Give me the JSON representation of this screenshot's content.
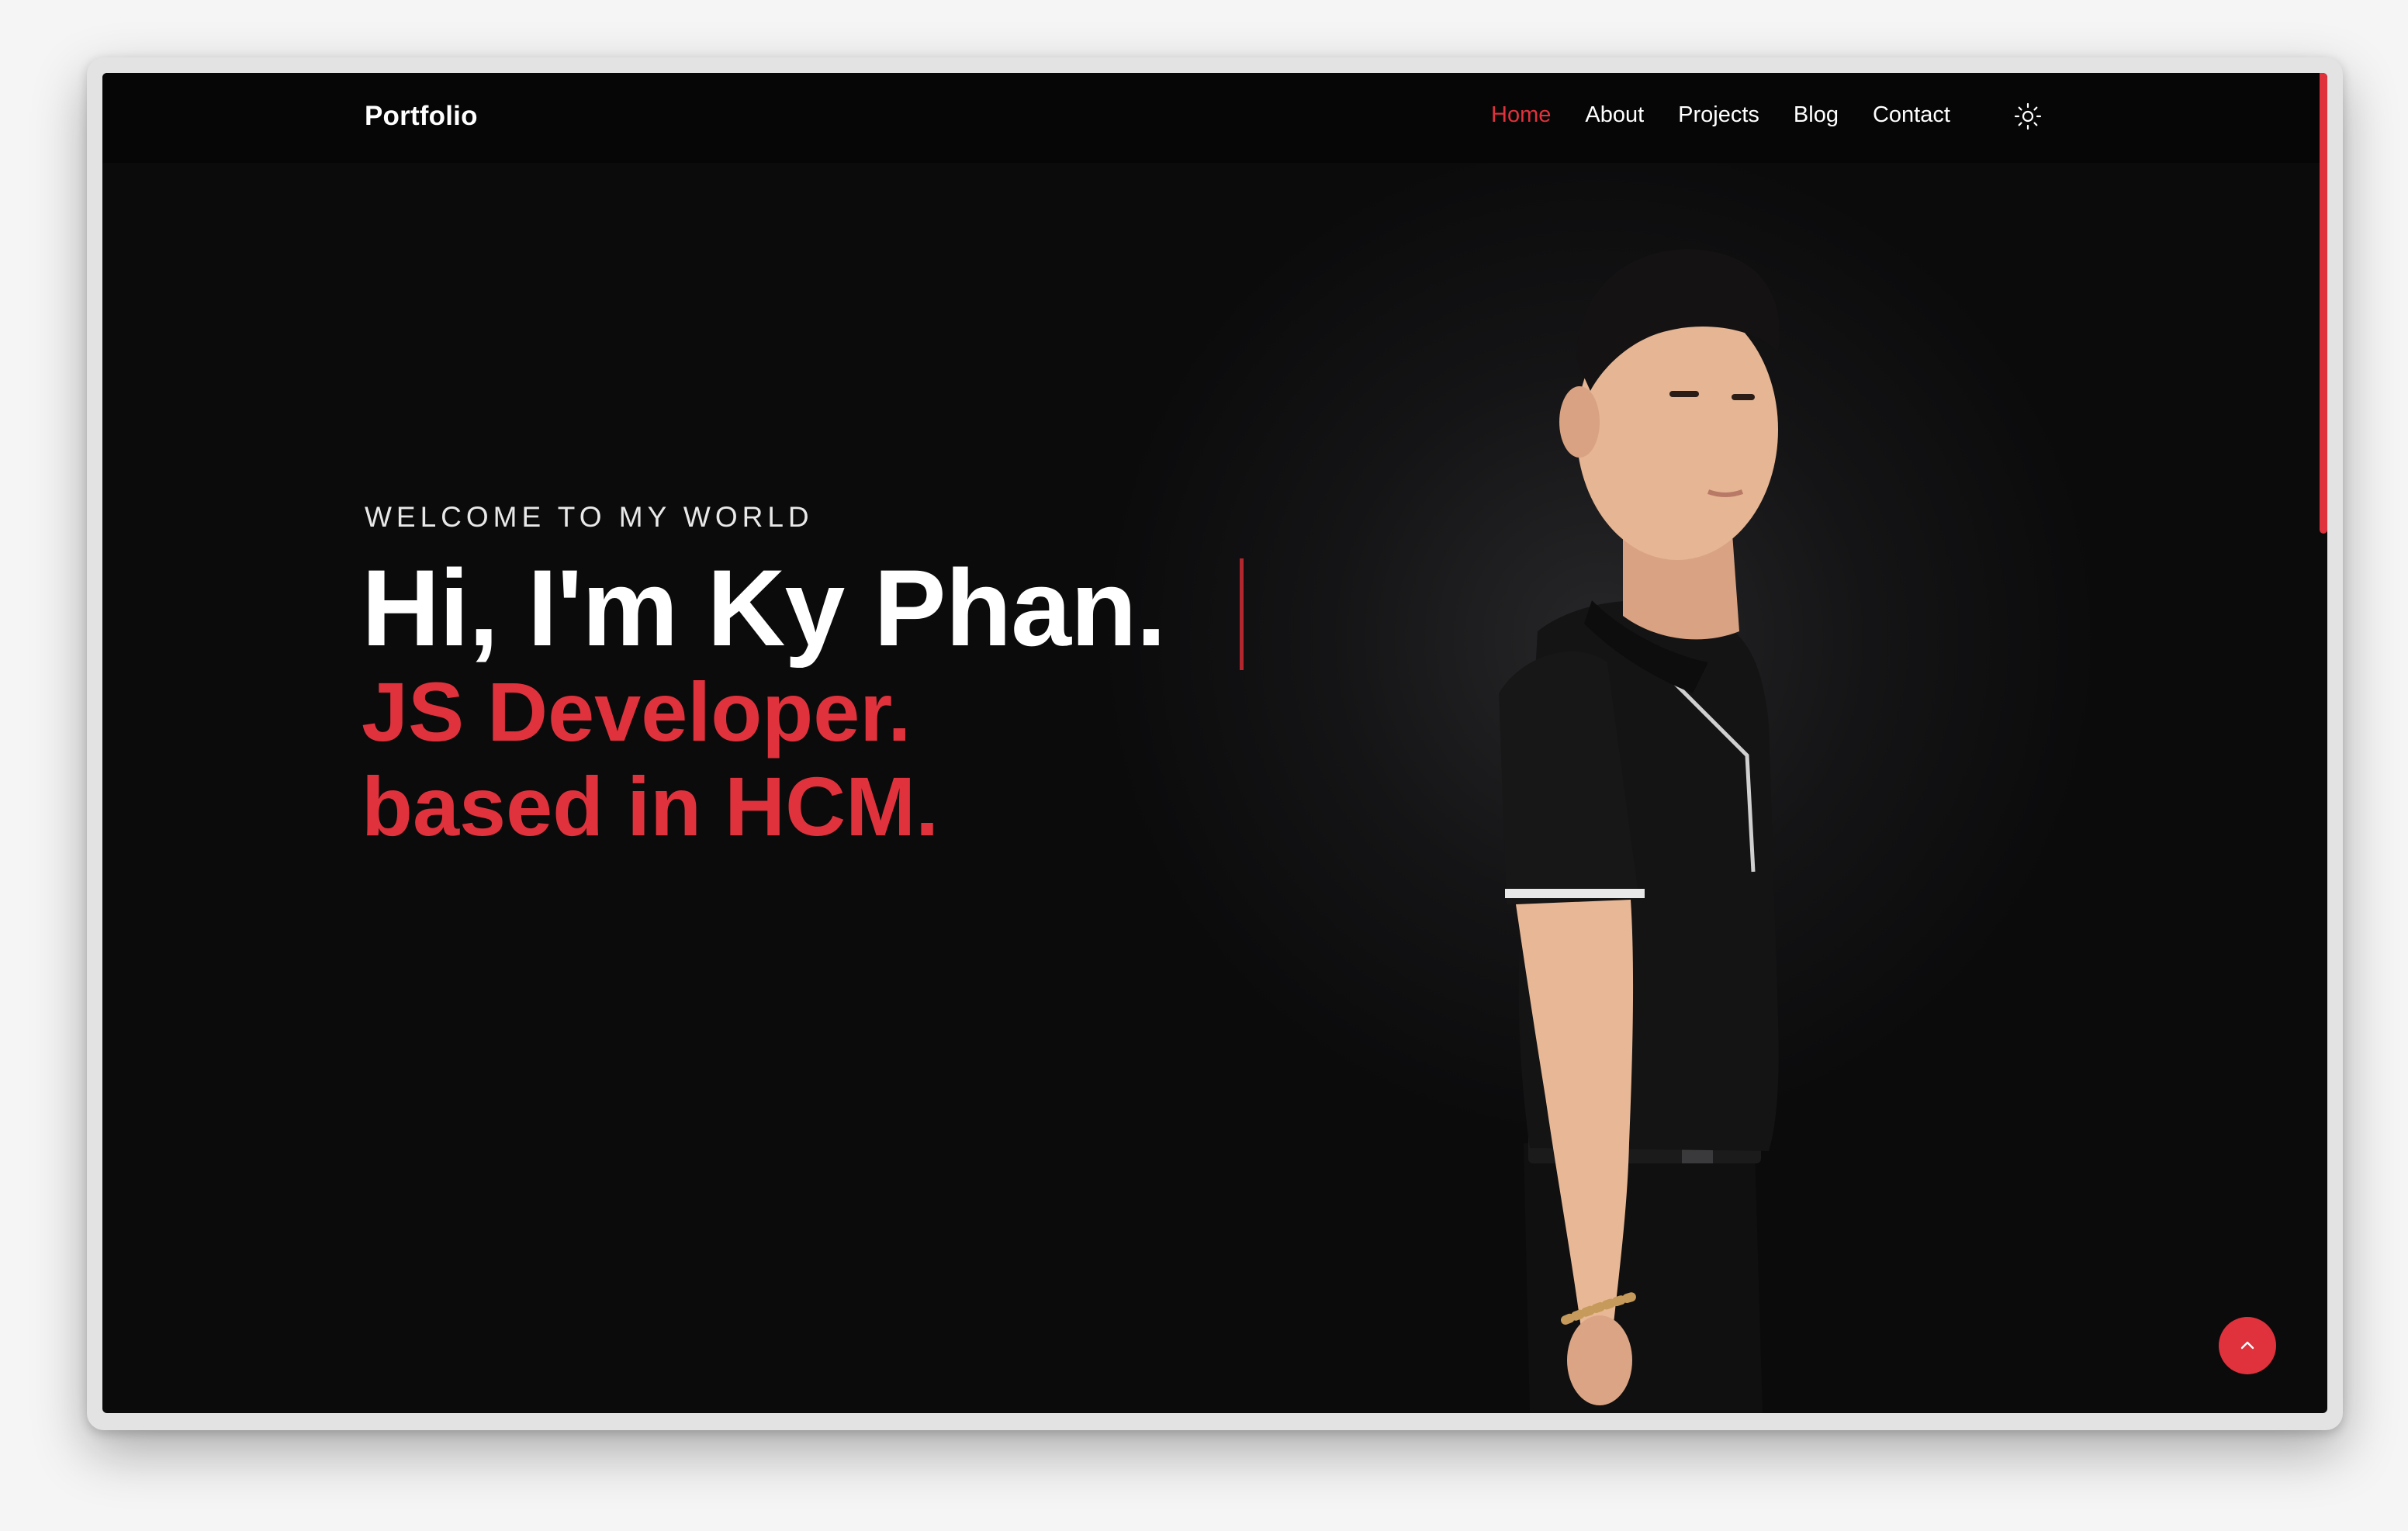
{
  "navbar": {
    "brand": "Portfolio",
    "links": [
      {
        "label": "Home",
        "active": true
      },
      {
        "label": "About",
        "active": false
      },
      {
        "label": "Projects",
        "active": false
      },
      {
        "label": "Blog",
        "active": false
      },
      {
        "label": "Contact",
        "active": false
      }
    ],
    "theme_toggle_icon": "sun-icon"
  },
  "hero": {
    "welcome": "WELCOME TO MY WORLD",
    "greeting": "Hi, I'm Ky Phan.",
    "role": "JS Developer.",
    "location": "based in HCM.",
    "photo_icon": "profile-photo"
  },
  "back_to_top_icon": "chevron-up-icon",
  "colors": {
    "accent": "#e0323c",
    "background": "#0b0b0c",
    "navbar": "#060606",
    "text": "#ffffff"
  }
}
